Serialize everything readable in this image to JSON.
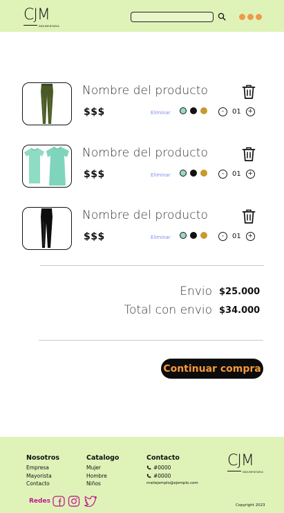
{
  "header": {
    "logo_text": "CJM",
    "logo_subtitle": "INDUMENTARIA",
    "search": {
      "placeholder": ""
    },
    "colors": {
      "bar": "#dff3b8",
      "menu_dots": "#ee9a4b"
    },
    "icons": [
      "search-icon",
      "menu-dots-icon"
    ]
  },
  "cart": {
    "items": [
      {
        "name": "Nombre del producto",
        "price": "$$$",
        "remove_label": "Eliminar",
        "quantity": "01",
        "image": "olive-green-leggings",
        "colors": [
          "#98d8c4",
          "#111111",
          "#c89a2e"
        ]
      },
      {
        "name": "Nombre del producto",
        "price": "$$$",
        "remove_label": "Eliminar",
        "quantity": "01",
        "image": "mint-t-shirts",
        "colors": [
          "#98d8c4",
          "#111111",
          "#c89a2e"
        ]
      },
      {
        "name": "Nombre del producto",
        "price": "$$$",
        "remove_label": "Eliminar",
        "quantity": "01",
        "image": "black-leggings",
        "colors": [
          "#98d8c4",
          "#111111",
          "#c89a2e"
        ]
      }
    ],
    "icons": [
      "trash-icon",
      "minus-icon",
      "plus-icon"
    ]
  },
  "summary": {
    "shipping_label": "Envio",
    "shipping_value": "$25.000",
    "total_label": "Total con envio",
    "total_value": "$34.000"
  },
  "cta": {
    "label": "Continuar compra",
    "bg": "#0c0c0c",
    "fg": "#f39a3c"
  },
  "footer": {
    "columns": [
      {
        "title": "Nosotros",
        "links": [
          "Empresa",
          "Mayorista",
          "Contacto"
        ]
      },
      {
        "title": "Catalogo",
        "links": [
          "Mujer",
          "Hombre",
          "Niños"
        ]
      },
      {
        "title": "Contacto",
        "phones": [
          "#0000",
          "#0000"
        ],
        "email": "mailejemplo@ejemplo.com"
      }
    ],
    "logo_text": "CJM",
    "logo_subtitle": "INDUMENTARIA",
    "social_label": "Redes",
    "social_icons": [
      "facebook-icon",
      "instagram-icon",
      "twitter-icon"
    ],
    "copyright": "Copyright 2023",
    "accent": "#c2188f"
  }
}
